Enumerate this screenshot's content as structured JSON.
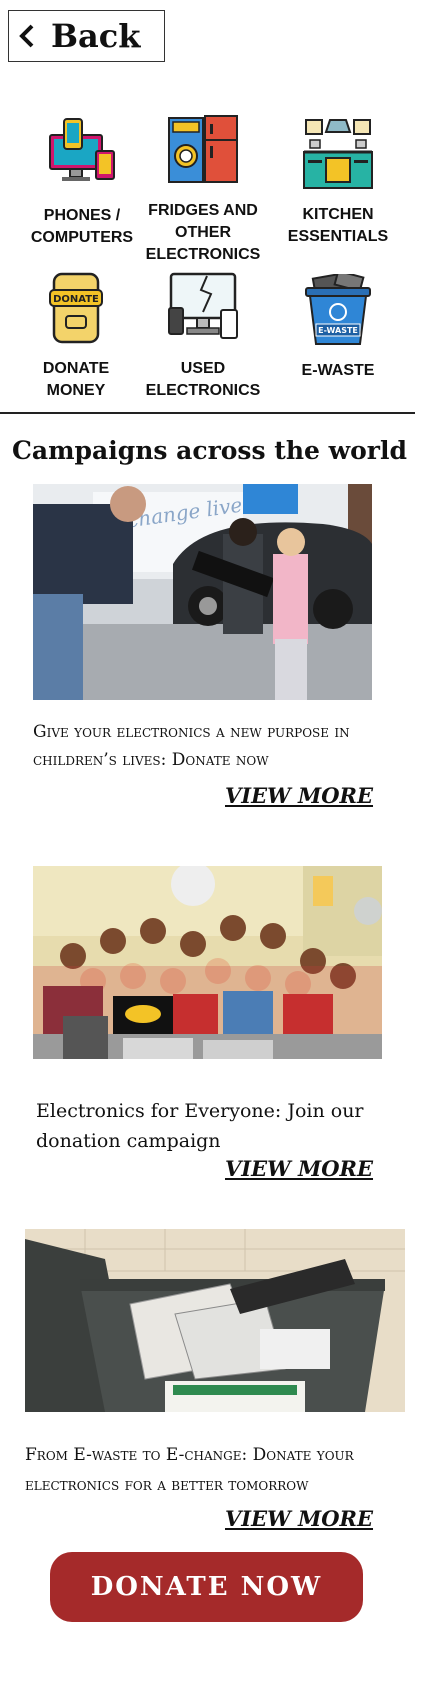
{
  "header": {
    "back_label": "Back"
  },
  "categories": [
    {
      "label": "PHONES / COMPUTERS",
      "icon": "phone-computer-icon"
    },
    {
      "label": "FRIDGES AND OTHER ELECTRONICS",
      "icon": "fridge-washer-icon"
    },
    {
      "label": "KITCHEN ESSENTIALS",
      "icon": "kitchen-icon"
    },
    {
      "label": "DONATE MONEY",
      "icon": "donate-phone-icon"
    },
    {
      "label": "USED ELECTRONICS",
      "icon": "broken-electronics-icon"
    },
    {
      "label": "E-WASTE",
      "icon": "ewaste-bin-icon",
      "badge": "E-WASTE"
    }
  ],
  "donate_badge": "DONATE",
  "section_title": "Campaigns across the world",
  "campaigns": [
    {
      "title": "Give your electronics a new purpose in children’s lives: Donate now",
      "link": "VIEW MORE",
      "image_text": "change lives"
    },
    {
      "title": "Electronics for Everyone: Join our donation campaign",
      "link": "VIEW MORE"
    },
    {
      "title": "From E-waste to E-change: Donate your electronics for a better tomorrow",
      "link": "VIEW MORE"
    }
  ],
  "donate_button": "DONATE NOW",
  "colors": {
    "accent": "#a52a2a",
    "divider": "#222222"
  }
}
